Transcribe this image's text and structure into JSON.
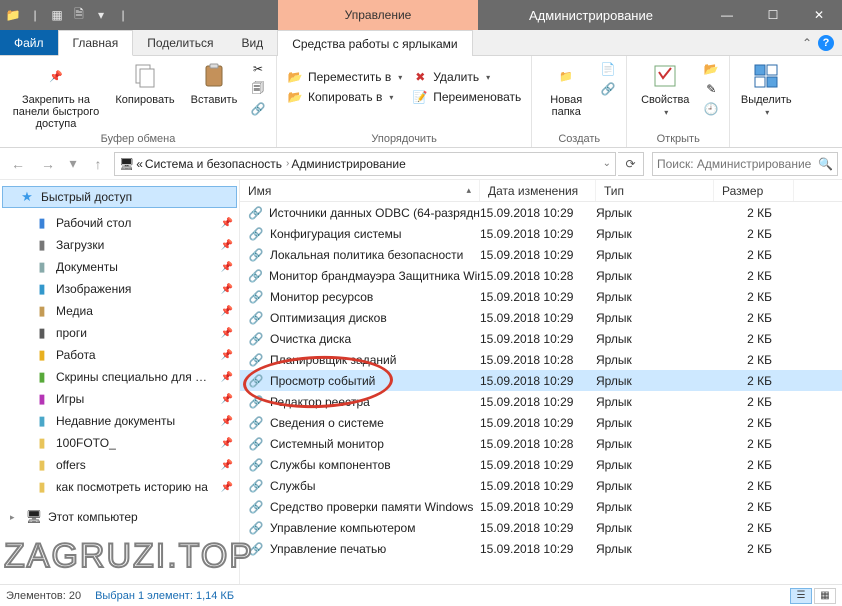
{
  "window": {
    "manage_label": "Управление",
    "title": "Администрирование"
  },
  "tabs": {
    "file": "Файл",
    "home": "Главная",
    "share": "Поделиться",
    "view": "Вид",
    "shortcut_tools": "Средства работы с ярлыками"
  },
  "ribbon": {
    "clipboard": {
      "caption": "Буфер обмена",
      "pin": "Закрепить на панели быстрого доступа",
      "copy": "Копировать",
      "paste": "Вставить"
    },
    "organize": {
      "caption": "Упорядочить",
      "move": "Переместить в",
      "copyto": "Копировать в",
      "delete": "Удалить",
      "rename": "Переименовать"
    },
    "create": {
      "caption": "Создать",
      "newfolder": "Новая папка"
    },
    "open": {
      "caption": "Открыть",
      "properties": "Свойства"
    },
    "select": {
      "caption": "",
      "selectall": "Выделить"
    }
  },
  "breadcrumb": {
    "b0_prefix": "«",
    "b0": "Система и безопасность",
    "b1": "Администрирование"
  },
  "search": {
    "placeholder": "Поиск: Администрирование"
  },
  "columns": {
    "name": "Имя",
    "date": "Дата изменения",
    "type": "Тип",
    "size": "Размер"
  },
  "sidebar": {
    "quick": "Быстрый доступ",
    "items": [
      {
        "label": "Рабочий стол",
        "color": "#3a82d8"
      },
      {
        "label": "Загрузки",
        "color": "#777"
      },
      {
        "label": "Документы",
        "color": "#8aa"
      },
      {
        "label": "Изображения",
        "color": "#3398cc"
      },
      {
        "label": "Медиа",
        "color": "#c49b55"
      },
      {
        "label": "проги",
        "color": "#5a5a5a"
      },
      {
        "label": "Работа",
        "color": "#e8b020"
      },
      {
        "label": "Скрины специально для …",
        "color": "#58a93a"
      },
      {
        "label": "Игры",
        "color": "#b535b5"
      },
      {
        "label": "Недавние документы",
        "color": "#4aa7c9"
      },
      {
        "label": "100FOTO_",
        "color": "#e8c45a"
      },
      {
        "label": "offers",
        "color": "#e8c45a"
      },
      {
        "label": "как посмотреть историю на",
        "color": "#e8c45a"
      }
    ],
    "this_pc": "Этот компьютер"
  },
  "files": [
    {
      "name": "Источники данных ODBC (64-разрядн…",
      "date": "15.09.2018 10:29",
      "type": "Ярлык",
      "size": "2 КБ"
    },
    {
      "name": "Конфигурация системы",
      "date": "15.09.2018 10:29",
      "type": "Ярлык",
      "size": "2 КБ"
    },
    {
      "name": "Локальная политика безопасности",
      "date": "15.09.2018 10:29",
      "type": "Ярлык",
      "size": "2 КБ"
    },
    {
      "name": "Монитор брандмауэра Защитника Win…",
      "date": "15.09.2018 10:28",
      "type": "Ярлык",
      "size": "2 КБ"
    },
    {
      "name": "Монитор ресурсов",
      "date": "15.09.2018 10:29",
      "type": "Ярлык",
      "size": "2 КБ"
    },
    {
      "name": "Оптимизация дисков",
      "date": "15.09.2018 10:29",
      "type": "Ярлык",
      "size": "2 КБ"
    },
    {
      "name": "Очистка диска",
      "date": "15.09.2018 10:29",
      "type": "Ярлык",
      "size": "2 КБ"
    },
    {
      "name": "Планировщик заданий",
      "date": "15.09.2018 10:28",
      "type": "Ярлык",
      "size": "2 КБ"
    },
    {
      "name": "Просмотр событий",
      "date": "15.09.2018 10:29",
      "type": "Ярлык",
      "size": "2 КБ",
      "selected": true
    },
    {
      "name": "Редактор реестра",
      "date": "15.09.2018 10:29",
      "type": "Ярлык",
      "size": "2 КБ"
    },
    {
      "name": "Сведения о системе",
      "date": "15.09.2018 10:29",
      "type": "Ярлык",
      "size": "2 КБ"
    },
    {
      "name": "Системный монитор",
      "date": "15.09.2018 10:28",
      "type": "Ярлык",
      "size": "2 КБ"
    },
    {
      "name": "Службы компонентов",
      "date": "15.09.2018 10:29",
      "type": "Ярлык",
      "size": "2 КБ"
    },
    {
      "name": "Службы",
      "date": "15.09.2018 10:29",
      "type": "Ярлык",
      "size": "2 КБ"
    },
    {
      "name": "Средство проверки памяти Windows",
      "date": "15.09.2018 10:29",
      "type": "Ярлык",
      "size": "2 КБ"
    },
    {
      "name": "Управление компьютером",
      "date": "15.09.2018 10:29",
      "type": "Ярлык",
      "size": "2 КБ"
    },
    {
      "name": "Управление печатью",
      "date": "15.09.2018 10:29",
      "type": "Ярлык",
      "size": "2 КБ"
    }
  ],
  "status": {
    "count_label": "Элементов: 20",
    "selected_label": "Выбран 1 элемент: 1,14 КБ"
  },
  "watermark": "ZAGRUZI.TOP"
}
